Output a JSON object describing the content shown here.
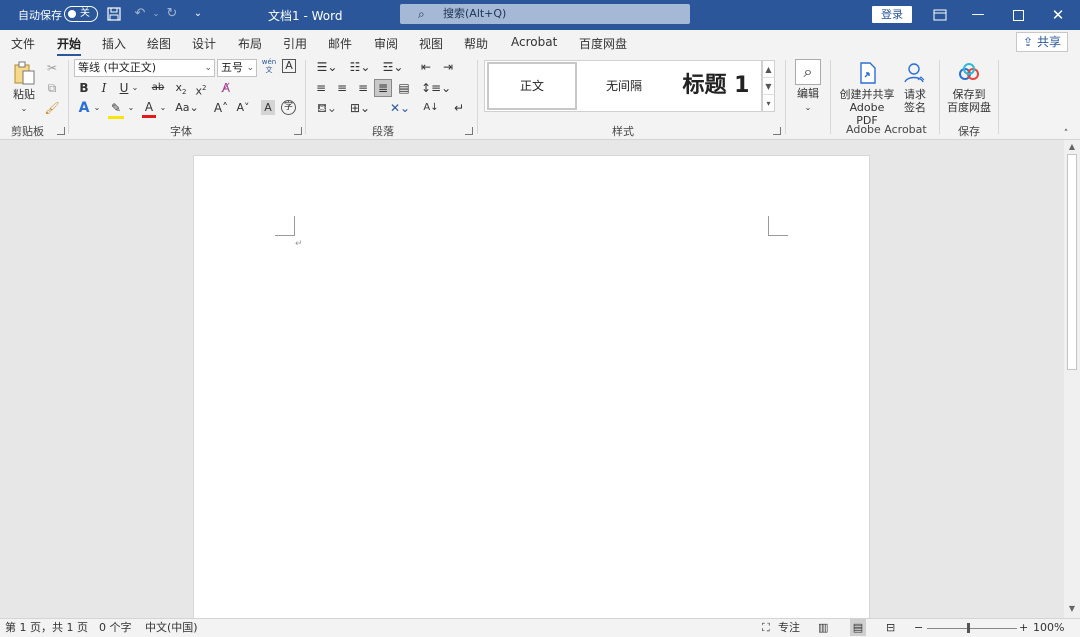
{
  "titlebar": {
    "autosave_label": "自动保存",
    "autosave_state": "关",
    "document_title": "文档1  -  Word",
    "search_placeholder": "搜索(Alt+Q)",
    "login_label": "登录",
    "bg_color": "#2b579a"
  },
  "tabs": [
    "文件",
    "开始",
    "插入",
    "绘图",
    "设计",
    "布局",
    "引用",
    "邮件",
    "审阅",
    "视图",
    "帮助",
    "Acrobat",
    "百度网盘"
  ],
  "active_tab": "开始",
  "share_label": "共享",
  "ribbon": {
    "clipboard": {
      "paste": "粘贴",
      "group": "剪贴板"
    },
    "font": {
      "name": "等线 (中文正文)",
      "size": "五号",
      "group": "字体",
      "wen_icon": "wén 文"
    },
    "paragraph": {
      "group": "段落"
    },
    "styles": {
      "items": [
        "正文",
        "无间隔",
        "标题 1"
      ],
      "group": "样式"
    },
    "editing": {
      "label": "编辑"
    },
    "acrobat": {
      "create_label_1": "创建并共享",
      "create_label_2": "Adobe PDF",
      "sign_label_1": "请求",
      "sign_label_2": "签名",
      "group": "Adobe Acrobat"
    },
    "save": {
      "label_1": "保存到",
      "label_2": "百度网盘",
      "group": "保存"
    }
  },
  "status": {
    "page": "第 1 页，共 1 页",
    "words": "0 个字",
    "language": "中文(中国)",
    "focus": "专注",
    "zoom": "100%"
  }
}
